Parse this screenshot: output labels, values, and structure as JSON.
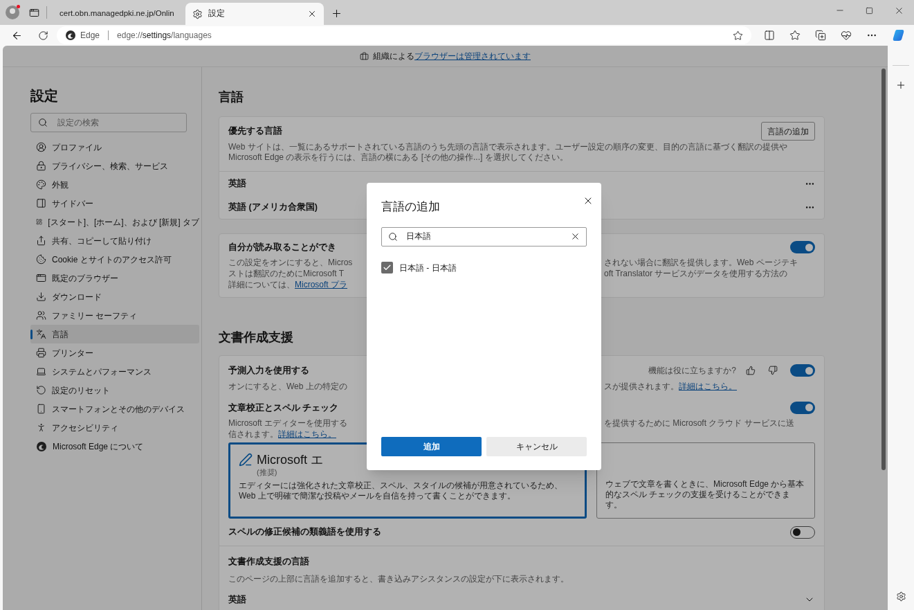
{
  "browser": {
    "tabs": [
      {
        "title": "cert.obn.managedpki.ne.jp/Onlin",
        "selected": false
      },
      {
        "title": "設定",
        "selected": true
      }
    ],
    "address": {
      "site": "Edge",
      "url": "edge://**settings**/languages"
    }
  },
  "managed_banner": {
    "text": "組織による",
    "link": "ブラウザーは管理されています"
  },
  "sidebar": {
    "title": "設定",
    "search": {
      "placeholder": "設定の検索"
    },
    "items": [
      {
        "label": "プロファイル",
        "selected": false
      },
      {
        "label": "プライバシー、検索、サービス",
        "selected": false
      },
      {
        "label": "外観",
        "selected": false
      },
      {
        "label": "サイドバー",
        "selected": false
      },
      {
        "label": "[スタート]、[ホーム]、および [新規] タブ",
        "selected": false
      },
      {
        "label": "共有、コピーして貼り付け",
        "selected": false
      },
      {
        "label": "Cookie とサイトのアクセス許可",
        "selected": false
      },
      {
        "label": "既定のブラウザー",
        "selected": false
      },
      {
        "label": "ダウンロード",
        "selected": false
      },
      {
        "label": "ファミリー セーフティ",
        "selected": false
      },
      {
        "label": "言語",
        "selected": true
      },
      {
        "label": "プリンター",
        "selected": false
      },
      {
        "label": "システムとパフォーマンス",
        "selected": false
      },
      {
        "label": "設定のリセット",
        "selected": false
      },
      {
        "label": "スマートフォンとその他のデバイス",
        "selected": false
      },
      {
        "label": "アクセシビリティ",
        "selected": false
      },
      {
        "label": "Microsoft Edge について",
        "selected": false
      }
    ]
  },
  "languages": {
    "heading": "言語",
    "preferred": {
      "title": "優先する言語",
      "add_button": "言語の追加",
      "description": "Web サイトは、一覧にあるサポートされている言語のうち先頭の言語で表示されます。ユーザー設定の順序の変更、目的の言語に基づく翻訳の提供や Microsoft Edge の表示を行うには、言語の横にある [その他の操作...] を選択してください。",
      "languages": [
        {
          "name": "英語"
        },
        {
          "name": "英語 (アメリカ合衆国)"
        }
      ]
    },
    "translate": {
      "title": "自分が読み取ることができ",
      "on": true,
      "lines": [
        {
          "left": "この設定をオンにすると、Micros",
          "right": "されない場合に翻訳を提供します。Web ページテキ"
        },
        {
          "left": "ストは翻訳のためにMicrosoft T",
          "right": "oft Translator サービスがデータを使用する方法の"
        }
      ],
      "last_line": {
        "text": "詳細については、",
        "link": "Microsoft プラ"
      }
    }
  },
  "writing": {
    "heading": "文書作成支援",
    "predictive": {
      "title": "予測入力を使用する",
      "feedback": "機能は役に立ちますか?",
      "on": true,
      "line": {
        "left": "オンにすると、Web 上の特定の",
        "right": "スが提供されます。",
        "link": "詳細はこちら。"
      }
    },
    "proofing": {
      "title": "文章校正とスペル チェック",
      "on": true,
      "line": {
        "left": "Microsoft エディターを使用する",
        "right": "を提供するために Microsoft クラウド サービスに送"
      },
      "line2": {
        "text": "信されます。",
        "link": "詳細はこちら。"
      }
    },
    "options": [
      {
        "title": "Microsoft エ",
        "badge": "(推奨)",
        "description": "エディターには強化された文章校正、スペル、スタイルの候補が用意されているため、Web 上で明確で簡潔な投稿やメールを自信を持って書くことができます。",
        "selected": true
      },
      {
        "description": "ウェブで文章を書くときに、Microsoft Edge から基本的なスペル チェックの支援を受けることができます。",
        "selected": false
      }
    ],
    "synonyms": {
      "title": "スペルの修正候補の類義語を使用する",
      "on": false
    },
    "assist_languages": {
      "title": "文書作成支援の言語",
      "description": "このページの上部に言語を追加すると、書き込みアシスタンスの設定が下に表示されます。",
      "languages": [
        {
          "name": "英語",
          "expanded": false
        }
      ]
    }
  },
  "dialog": {
    "title": "言語の追加",
    "search": {
      "value": "日本語"
    },
    "results": [
      {
        "label": "日本語 - 日本語",
        "checked": true
      }
    ],
    "buttons": [
      {
        "label": "追加",
        "kind": "primary"
      },
      {
        "label": "キャンセル",
        "kind": "secondary"
      }
    ]
  }
}
